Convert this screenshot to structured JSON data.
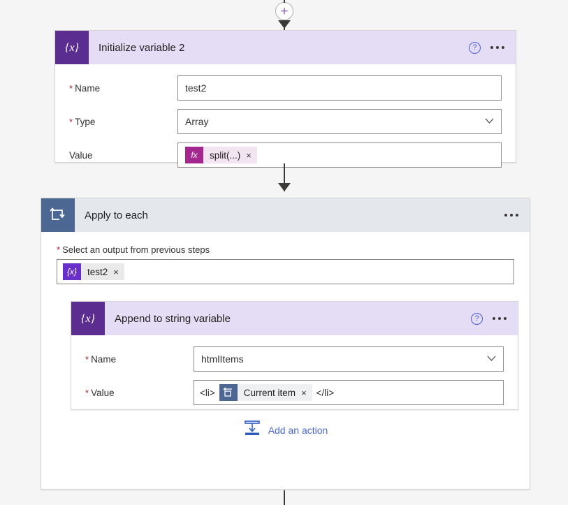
{
  "connectors": {
    "add_step_plus": "+"
  },
  "cards": {
    "initialize_variable": {
      "icon": "variable-braces-icon",
      "title": "Initialize variable 2",
      "help_icon": "?",
      "more_icon": "ellipsis-icon",
      "fields": [
        {
          "label": "Name",
          "required": true,
          "value": "test2",
          "kind": "text"
        },
        {
          "label": "Type",
          "required": true,
          "value": "Array",
          "kind": "dropdown",
          "chevron": "⌄"
        },
        {
          "label": "Value",
          "required": false,
          "kind": "token",
          "token": {
            "badge": "fx",
            "text": "split(...)",
            "close": "×"
          }
        }
      ]
    },
    "apply_to_each": {
      "icon": "loop-arrow-icon",
      "title": "Apply to each",
      "more_icon": "ellipsis-icon",
      "select_output_label": "Select an output from previous steps",
      "select_output_required": true,
      "selected_token": {
        "badge": "{x}",
        "text": "test2",
        "close": "×"
      },
      "add_action": {
        "icon": "insert-action-icon",
        "label": "Add an action"
      }
    },
    "append_to_string": {
      "icon": "variable-braces-icon",
      "title": "Append to string variable",
      "help_icon": "?",
      "more_icon": "ellipsis-icon",
      "fields": [
        {
          "label": "Name",
          "required": true,
          "value": "htmlItems",
          "kind": "dropdown",
          "chevron": "⌄"
        },
        {
          "label": "Value",
          "required": true,
          "kind": "mixed",
          "prefix_text": "<li>",
          "token": {
            "badge": "current-item-icon",
            "text": "Current item",
            "close": "×"
          },
          "suffix_text": "</li>"
        }
      ]
    }
  },
  "colors": {
    "page_background": "#f5f5f5",
    "purple_icon": "#5c2d91",
    "purple_header": "#e5ddf5",
    "slate_icon": "#4c6792",
    "gray_header": "#e4e7ec",
    "magenta_badge": "#a4278f",
    "link_blue": "#4a69d4",
    "required_red": "#a4262c",
    "connector_gray": "#3b3a39"
  }
}
